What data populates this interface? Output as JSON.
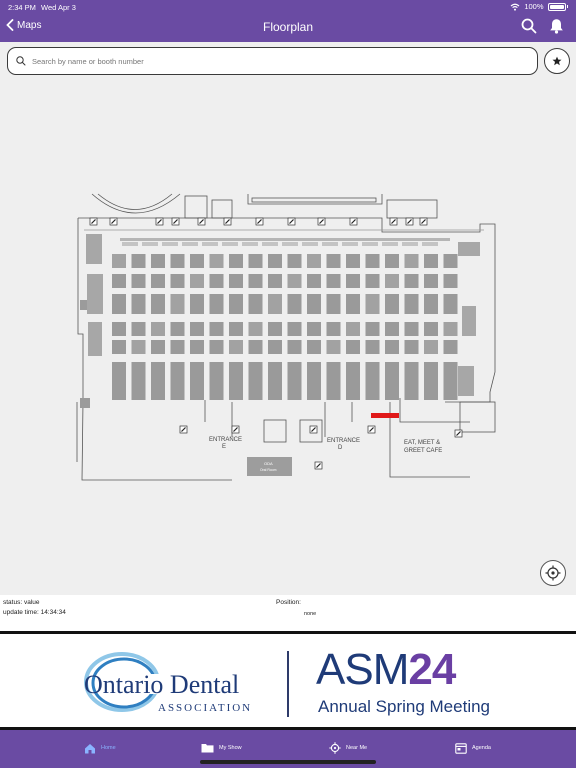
{
  "status_bar": {
    "time": "2:34 PM",
    "date": "Wed Apr 3",
    "battery": "100%"
  },
  "nav": {
    "back_label": "Maps",
    "title": "Floorplan"
  },
  "search": {
    "placeholder": "Search by name or booth number"
  },
  "floorplan": {
    "labels": {
      "entrance_e_1": "ENTRANCE",
      "entrance_e_2": "E",
      "entrance_d_1": "ENTRANCE",
      "entrance_d_2": "D",
      "cafe_1": "EAT, MEET &",
      "cafe_2": "GREET CAFE",
      "oda_1": "ODA",
      "oda_2": "Oral Room"
    }
  },
  "info": {
    "status": "status: value",
    "update_time": "update time:  14:34:34",
    "position_label": "Position:",
    "position_value": "none"
  },
  "banner": {
    "oda_line1": "Ontario Dental",
    "oda_line2": "ASSOCIATION",
    "asm_a": "ASM",
    "asm_num": "24",
    "asm_sub": "Annual Spring Meeting"
  },
  "tabs": [
    {
      "label": "Home",
      "icon": "home-icon",
      "active": true
    },
    {
      "label": "My Show",
      "icon": "folder-icon",
      "active": false
    },
    {
      "label": "Near Me",
      "icon": "location-icon",
      "active": false
    },
    {
      "label": "Agenda",
      "icon": "calendar-icon",
      "active": false
    }
  ],
  "colors": {
    "brand": "#6a4ba3",
    "highlight_booth": "#e01818",
    "tab_active": "#8ab4ff"
  }
}
